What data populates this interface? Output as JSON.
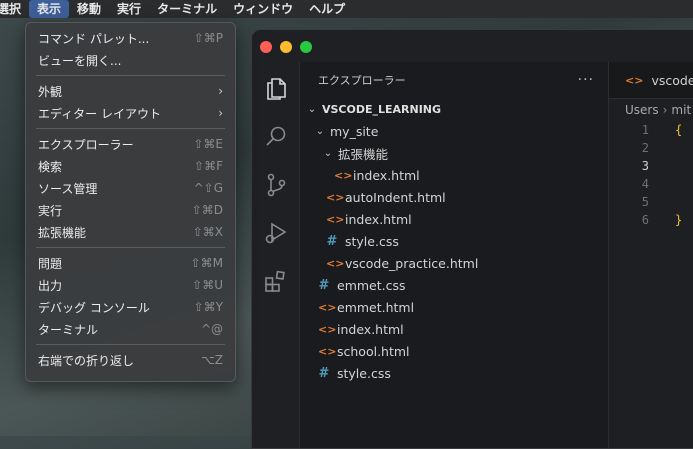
{
  "menubar": {
    "items": [
      "選択",
      "表示",
      "移動",
      "実行",
      "ターミナル",
      "ウィンドウ",
      "ヘルプ"
    ],
    "active": "表示"
  },
  "menu": {
    "command_palette": {
      "label": "コマンド パレット...",
      "shortcut": "⇧⌘P"
    },
    "open_view": {
      "label": "ビューを開く..."
    },
    "appearance": {
      "label": "外観",
      "submenu": "›"
    },
    "editor_layout": {
      "label": "エディター レイアウト",
      "submenu": "›"
    },
    "explorer": {
      "label": "エクスプローラー",
      "shortcut": "⇧⌘E"
    },
    "search": {
      "label": "検索",
      "shortcut": "⇧⌘F"
    },
    "scm": {
      "label": "ソース管理",
      "shortcut": "^⇧G"
    },
    "run": {
      "label": "実行",
      "shortcut": "⇧⌘D"
    },
    "extensions": {
      "label": "拡張機能",
      "shortcut": "⇧⌘X"
    },
    "problems": {
      "label": "問題",
      "shortcut": "⇧⌘M"
    },
    "output": {
      "label": "出力",
      "shortcut": "⇧⌘U"
    },
    "debug_console": {
      "label": "デバッグ コンソール",
      "shortcut": "⇧⌘Y"
    },
    "terminal": {
      "label": "ターミナル",
      "shortcut": "^@"
    },
    "word_wrap": {
      "label": "右端での折り返し",
      "shortcut": "⌥Z"
    }
  },
  "explorer": {
    "title": "エクスプローラー",
    "more": "···",
    "root": "VSCODE_LEARNING",
    "tree": [
      {
        "label": "my_site",
        "type": "folder",
        "depth": 1
      },
      {
        "label": "拡張機能",
        "type": "folder",
        "depth": 2
      },
      {
        "label": "index.html",
        "type": "html",
        "depth": 3
      },
      {
        "label": "autoIndent.html",
        "type": "html",
        "depth": 2
      },
      {
        "label": "index.html",
        "type": "html",
        "depth": 2
      },
      {
        "label": "style.css",
        "type": "css",
        "depth": 2
      },
      {
        "label": "vscode_practice.html",
        "type": "html",
        "depth": 2
      },
      {
        "label": "emmet.css",
        "type": "css",
        "depth": 1
      },
      {
        "label": "emmet.html",
        "type": "html",
        "depth": 1
      },
      {
        "label": "index.html",
        "type": "html",
        "depth": 1
      },
      {
        "label": "school.html",
        "type": "html",
        "depth": 1
      },
      {
        "label": "style.css",
        "type": "css",
        "depth": 1
      }
    ]
  },
  "editor": {
    "tab_label": "vscode_",
    "breadcrumb": [
      "Users",
      "mit"
    ],
    "lines": [
      {
        "n": "1",
        "text": "{"
      },
      {
        "n": "2",
        "text": ""
      },
      {
        "n": "3",
        "text": ""
      },
      {
        "n": "4",
        "text": ""
      },
      {
        "n": "5",
        "text": ""
      },
      {
        "n": "6",
        "text": "}"
      }
    ],
    "current_line": "3"
  },
  "icons": {
    "explorer": "files-icon",
    "search": "search-icon",
    "scm": "source-control-icon",
    "run": "run-debug-icon",
    "extensions": "extensions-icon",
    "html_file": "<>",
    "css_file": "#"
  }
}
